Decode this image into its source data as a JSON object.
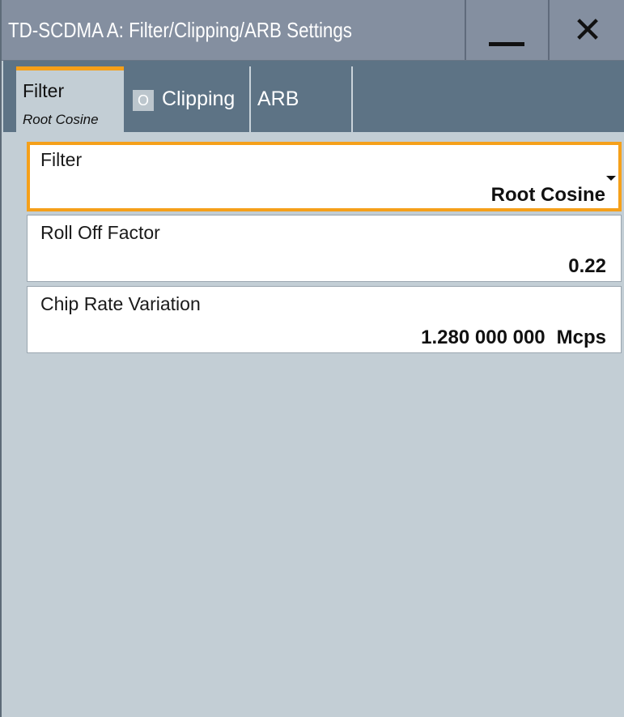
{
  "window": {
    "title": "TD-SCDMA A: Filter/Clipping/ARB Settings",
    "close_symbol": "✕"
  },
  "tabs": [
    {
      "label": "Filter",
      "sublabel": "Root Cosine",
      "active": true
    },
    {
      "label": "Clipping",
      "toggle_text": "O",
      "active": false
    },
    {
      "label": "ARB",
      "active": false
    }
  ],
  "fields": {
    "filter": {
      "label": "Filter",
      "value": "Root Cosine"
    },
    "roll_off": {
      "label": "Roll Off Factor",
      "value": "0.22"
    },
    "chip_rate": {
      "label": "Chip Rate Variation",
      "value": "1.280 000 000",
      "unit": "Mcps"
    }
  },
  "icons": {
    "minimize": "minimize-icon",
    "close": "close-icon",
    "dropdown": "chevron-down-icon"
  },
  "colors": {
    "title_bar": "#848fa0",
    "tab_strip": "#5d7385",
    "accent": "#f5a01a",
    "panel_background": "#c3ced5"
  }
}
